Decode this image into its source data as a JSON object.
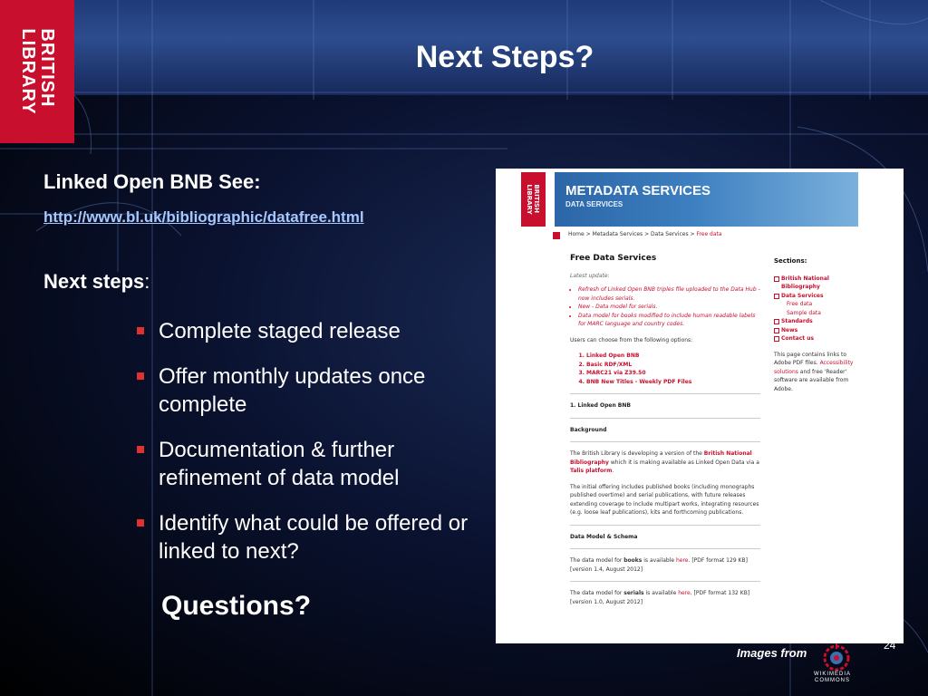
{
  "logo": {
    "text": "BRITISH\nLIBRARY"
  },
  "slide": {
    "title": "Next Steps?",
    "heading1": "Linked Open BNB See:",
    "link": "http://www.bl.uk/bibliographic/datafree.html",
    "heading2_bold": "Next steps",
    "heading2_rest": ":",
    "bullets": [
      "Complete staged release",
      "Offer monthly updates once complete",
      "Documentation & further refinement of data model",
      "Identify what could be offered or linked to next?"
    ],
    "questions": "Questions?",
    "page_number": "24",
    "credit": "Images from"
  },
  "colors": {
    "logo_red": "#c8102e",
    "link": "#a6c8ff",
    "bullet": "#e03030"
  },
  "panel": {
    "logo_text": "BRITISH\nLIBRARY",
    "banner_title": "METADATA SERVICES",
    "banner_sub": "DATA SERVICES",
    "crumbs": {
      "home": "Home",
      "sep1": " > ",
      "meta": "Metadata Services",
      "sep2": " > ",
      "data": "Data Services",
      "sep3": " > ",
      "current": "Free data"
    },
    "main": {
      "heading": "Free Data Services",
      "latest": "Latest update:",
      "updates": [
        "Refresh of Linked Open BNB triples file uploaded to the Data Hub - now includes serials.",
        "New - Data model for serials.",
        "Data model for books modified to include human readable labels for MARC language and country codes."
      ],
      "choose": "Users can choose from the following options:",
      "options": [
        "Linked Open BNB",
        "Basic RDF/XML",
        "MARC21 via Z39.50",
        "BNB New Titles - Weekly PDF Files"
      ],
      "section1": "1. Linked Open BNB",
      "background_h": "Background",
      "bg_p1_a": "The British Library is developing a version of the ",
      "bg_p1_b": "British National Bibliography",
      "bg_p1_c": " which it is making available as Linked Open Data via a ",
      "bg_p1_d": "Talis platform",
      "bg_p1_e": ".",
      "bg_p2": "The initial offering includes published books (including monographs published overtime) and serial publications, with future releases extending coverage to include multipart works, integrating resources (e.g. loose leaf publications), kits and forthcoming publications.",
      "model_h": "Data Model & Schema",
      "books_a": "The data model for ",
      "books_b": "books",
      "books_c": " is available ",
      "books_d": "here",
      "books_e": ". [PDF format 129 KB]",
      "books_ver": "[version 1.4, August 2012]",
      "serials_a": "The data model for ",
      "serials_b": "serials",
      "serials_c": " is available ",
      "serials_d": "here",
      "serials_e": ". [PDF format 132 KB]",
      "serials_ver": "[version 1.0, August 2012]"
    },
    "side": {
      "heading": "Sections:",
      "sections": [
        "British National Bibliography",
        "Data Services"
      ],
      "subs": [
        "Free data",
        "Sample data"
      ],
      "sections2": [
        "Standards",
        "News",
        "Contact us"
      ],
      "note_a": "This page contains links to Adobe PDF files. ",
      "note_b": "Accessibility solutions",
      "note_c": " and free 'Reader' software are available from Adobe."
    }
  },
  "wikimedia": {
    "text": "WIKIMEDIA\nCOMMONS"
  }
}
